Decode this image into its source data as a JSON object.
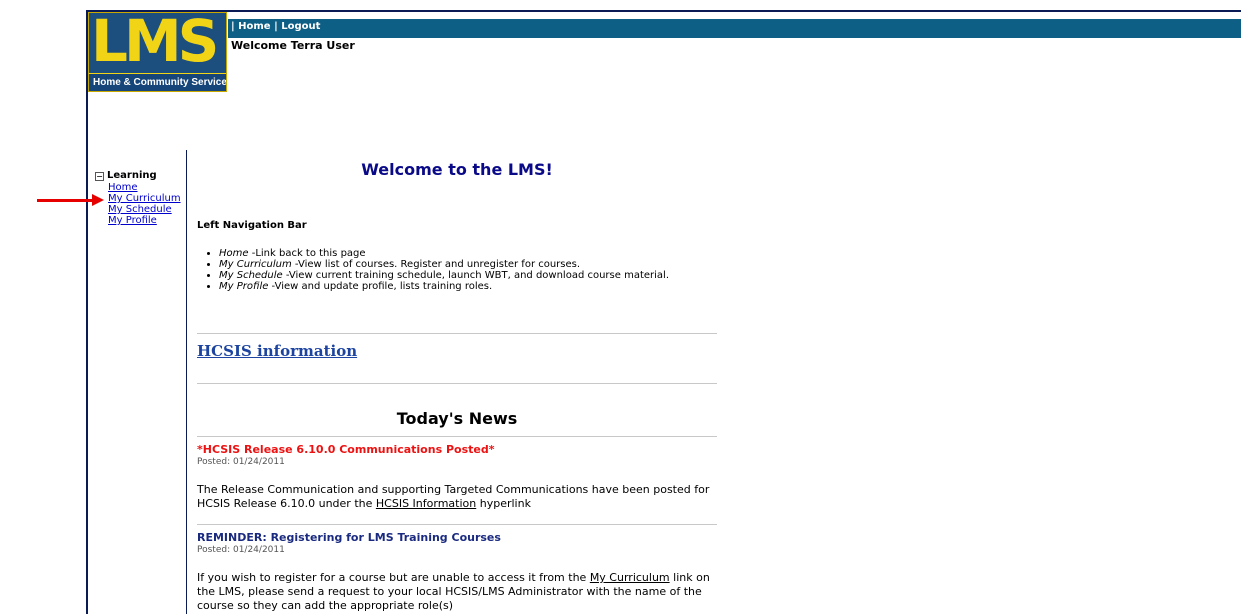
{
  "logo": {
    "text": "LMS",
    "subtitle": "Home & Community Services"
  },
  "topnav": {
    "separator1": "| ",
    "home": "Home",
    "separator2": " | ",
    "logout": "Logout"
  },
  "welcome_user": "Welcome Terra User",
  "leftnav": {
    "section_toggle": "−",
    "section_label": "Learning",
    "items": [
      {
        "label": "Home"
      },
      {
        "label": "My Curriculum"
      },
      {
        "label": "My Schedule"
      },
      {
        "label": "My Profile"
      }
    ]
  },
  "main": {
    "title": "Welcome to the LMS!",
    "left_nav_heading": "Left Navigation Bar",
    "bullets": [
      {
        "term": "Home",
        "desc": " -Link back to this page"
      },
      {
        "term": "My Curriculum",
        "desc": " -View list of courses. Register and unregister for courses."
      },
      {
        "term": "My Schedule",
        "desc": " -View current training schedule, launch WBT, and download course material."
      },
      {
        "term": "My Profile",
        "desc": " -View and update profile, lists training roles."
      }
    ],
    "hcsis_link": "HCSIS information",
    "news_title": "Today's News",
    "news": [
      {
        "headline": "*HCSIS Release 6.10.0 Communications Posted*",
        "date": "Posted: 01/24/2011",
        "body_pre": "The Release Communication and supporting Targeted Communications have been posted for HCSIS Release 6.10.0 under the ",
        "body_link": "HCSIS Information",
        "body_post": " hyperlink"
      },
      {
        "headline": "REMINDER: Registering for LMS Training Courses",
        "date": "Posted: 01/24/2011",
        "body_pre": "If you wish to register for a course but are unable to access it from the ",
        "body_link": "My Curriculum",
        "body_post": " link on the LMS, please send a request to your local HCSIS/LMS Administrator with the name of the course so they can add the appropriate role(s)"
      }
    ]
  },
  "colors": {
    "topbar": "#0e5f86",
    "logo_yellow": "#f2d416",
    "arrow": "#e60000",
    "link": "#0000cc"
  }
}
